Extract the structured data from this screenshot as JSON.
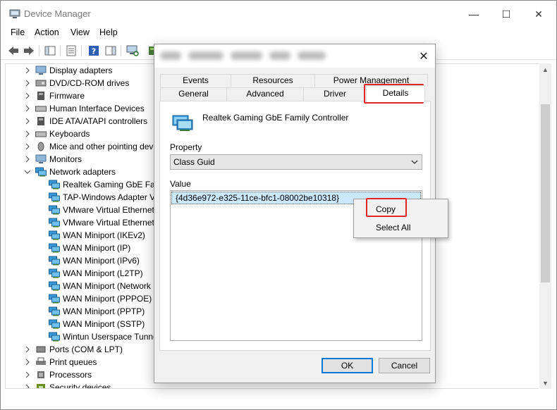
{
  "window": {
    "title": "Device Manager",
    "controls": {
      "minimize": "—",
      "maximize": "☐",
      "close": "✕"
    }
  },
  "menu": [
    "File",
    "Action",
    "View",
    "Help"
  ],
  "tree": {
    "items": [
      {
        "label": "Display adapters",
        "icon": "display-adapter-icon",
        "expanded": false,
        "level": 0
      },
      {
        "label": "DVD/CD-ROM drives",
        "icon": "dvd-drive-icon",
        "expanded": false,
        "level": 0
      },
      {
        "label": "Firmware",
        "icon": "firmware-icon",
        "expanded": false,
        "level": 0
      },
      {
        "label": "Human Interface Devices",
        "icon": "hid-icon",
        "expanded": false,
        "level": 0
      },
      {
        "label": "IDE ATA/ATAPI controllers",
        "icon": "ide-controller-icon",
        "expanded": false,
        "level": 0
      },
      {
        "label": "Keyboards",
        "icon": "keyboard-icon",
        "expanded": false,
        "level": 0
      },
      {
        "label": "Mice and other pointing dev",
        "icon": "mouse-icon",
        "expanded": false,
        "level": 0
      },
      {
        "label": "Monitors",
        "icon": "monitor-icon",
        "expanded": false,
        "level": 0
      },
      {
        "label": "Network adapters",
        "icon": "network-adapter-icon",
        "expanded": true,
        "level": 0
      },
      {
        "label": "Realtek Gaming GbE Fam",
        "icon": "network-adapter-icon",
        "level": 1
      },
      {
        "label": "TAP-Windows Adapter V9",
        "icon": "network-adapter-icon",
        "level": 1
      },
      {
        "label": "VMware Virtual Ethernet A",
        "icon": "network-adapter-icon",
        "level": 1
      },
      {
        "label": "VMware Virtual Ethernet A",
        "icon": "network-adapter-icon",
        "level": 1
      },
      {
        "label": "WAN Miniport (IKEv2)",
        "icon": "network-adapter-icon",
        "level": 1
      },
      {
        "label": "WAN Miniport (IP)",
        "icon": "network-adapter-icon",
        "level": 1
      },
      {
        "label": "WAN Miniport (IPv6)",
        "icon": "network-adapter-icon",
        "level": 1
      },
      {
        "label": "WAN Miniport (L2TP)",
        "icon": "network-adapter-icon",
        "level": 1
      },
      {
        "label": "WAN Miniport (Network",
        "icon": "network-adapter-icon",
        "level": 1
      },
      {
        "label": "WAN Miniport (PPPOE)",
        "icon": "network-adapter-icon",
        "level": 1
      },
      {
        "label": "WAN Miniport (PPTP)",
        "icon": "network-adapter-icon",
        "level": 1
      },
      {
        "label": "WAN Miniport (SSTP)",
        "icon": "network-adapter-icon",
        "level": 1
      },
      {
        "label": "Wintun Userspace Tunne",
        "icon": "network-adapter-icon",
        "level": 1
      },
      {
        "label": "Ports (COM & LPT)",
        "icon": "port-icon",
        "expanded": false,
        "level": 0
      },
      {
        "label": "Print queues",
        "icon": "printer-icon",
        "expanded": false,
        "level": 0
      },
      {
        "label": "Processors",
        "icon": "processor-icon",
        "expanded": false,
        "level": 0
      },
      {
        "label": "Security devices",
        "icon": "security-device-icon",
        "expanded": false,
        "level": 0
      }
    ]
  },
  "dialog": {
    "close": "✕",
    "tabs_row1": [
      "Events",
      "Resources",
      "Power Management"
    ],
    "tabs_row2": [
      "General",
      "Advanced",
      "Driver",
      "Details"
    ],
    "active_tab": "Details",
    "device_name": "Realtek Gaming GbE Family Controller",
    "property_label": "Property",
    "property_value": "Class Guid",
    "value_label": "Value",
    "value_item": "{4d36e972-e325-11ce-bfc1-08002be10318}",
    "ok": "OK",
    "cancel": "Cancel"
  },
  "context_menu": {
    "copy": "Copy",
    "select_all": "Select All"
  },
  "colors": {
    "highlight": "#e3242b",
    "selection": "#cce8ff",
    "accent": "#0078d7",
    "dialog_bg": "#f0f0f0"
  }
}
